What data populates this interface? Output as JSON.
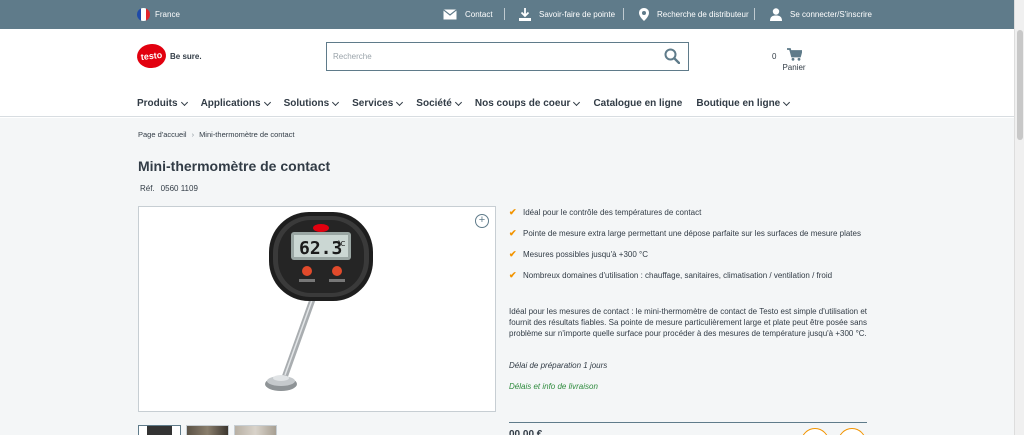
{
  "topbar": {
    "country": "France",
    "contact": "Contact",
    "savoir_faire": "Savoir-faire de pointe",
    "distributeur": "Recherche de distributeur",
    "login": "Se connecter/S'inscrire"
  },
  "brand": {
    "logo_text": "testo",
    "tagline": "Be sure."
  },
  "search": {
    "placeholder": "Recherche"
  },
  "cart": {
    "count": "0",
    "label": "Panier"
  },
  "nav": {
    "items": [
      {
        "label": "Produits"
      },
      {
        "label": "Applications"
      },
      {
        "label": "Solutions"
      },
      {
        "label": "Services"
      },
      {
        "label": "Société"
      },
      {
        "label": "Nos coups de coeur"
      },
      {
        "label": "Catalogue en ligne"
      },
      {
        "label": "Boutique en ligne"
      }
    ]
  },
  "breadcrumb": {
    "home": "Page d'accueil",
    "current": "Mini-thermomètre de contact"
  },
  "product": {
    "title": "Mini-thermomètre de contact",
    "ref_label": "Réf.",
    "ref_value": "0560 1109",
    "display_value": "62.3",
    "display_unit": "°C",
    "features": [
      "Idéal pour le contrôle des températures de contact",
      "Pointe de mesure extra large permettant une dépose parfaite sur les surfaces de mesure plates",
      "Mesures possibles jusqu'à +300 °C",
      "Nombreux domaines d'utilisation : chauffage, sanitaires, climatisation / ventilation / froid"
    ],
    "description": "Idéal pour les mesures de contact : le mini-thermomètre de contact de Testo est simple d'utilisation et fournit des résultats fiables. Sa pointe de mesure particulièrement large et plate peut être posée sans problème sur n'importe quelle surface pour procéder à des mesures de température jusqu'à +300 °C.",
    "delay": "Délai de préparation 1 jours",
    "delivery_link": "Délais et info de livraison",
    "price_peek": "00,00 €"
  },
  "colors": {
    "topbar": "#5f7b8a",
    "accent": "#f29400",
    "brand_red": "#e2000f",
    "link_green": "#2e8b3d"
  }
}
